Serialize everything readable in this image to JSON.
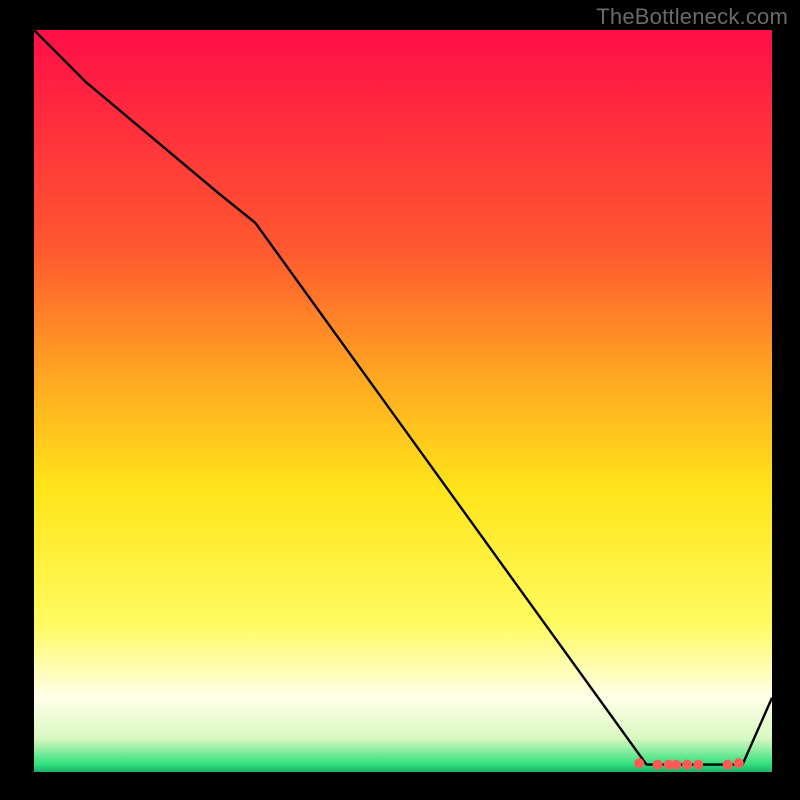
{
  "watermark": "TheBottleneck.com",
  "colors": {
    "background": "#000000",
    "watermark": "#6a6a6a",
    "line": "#000000",
    "marker": "#ff5a55",
    "gradient_top": "#ff0e47",
    "gradient_mid_upper": "#ff8a2b",
    "gradient_mid": "#ffd21a",
    "gradient_mid_lower": "#fff33a",
    "gradient_pale": "#ffffe0",
    "gradient_green": "#2fe07e"
  },
  "chart_data": {
    "type": "line",
    "title": "",
    "xlabel": "",
    "ylabel": "",
    "xlim": [
      0,
      100
    ],
    "ylim": [
      0,
      100
    ],
    "series": [
      {
        "name": "curve",
        "x": [
          0,
          7,
          25,
          30,
          83,
          96,
          100
        ],
        "values": [
          100,
          93,
          78,
          74,
          1,
          1,
          10
        ]
      }
    ],
    "markers": {
      "name": "highlight-points",
      "x": [
        82,
        84.5,
        86,
        87,
        88.5,
        90,
        94,
        95.5
      ],
      "values": [
        1.2,
        1.0,
        1.0,
        1.0,
        1.0,
        1.0,
        1.0,
        1.2
      ]
    },
    "background_gradient": {
      "direction": "vertical",
      "stops": [
        {
          "pos": 0.0,
          "color": "#ff0e47"
        },
        {
          "pos": 0.3,
          "color": "#ff5a2f"
        },
        {
          "pos": 0.48,
          "color": "#ffad20"
        },
        {
          "pos": 0.62,
          "color": "#ffe51a"
        },
        {
          "pos": 0.8,
          "color": "#fffb60"
        },
        {
          "pos": 0.9,
          "color": "#ffffe9"
        },
        {
          "pos": 0.955,
          "color": "#d9f8c0"
        },
        {
          "pos": 0.99,
          "color": "#2fe07e"
        },
        {
          "pos": 1.0,
          "color": "#1fae68"
        }
      ]
    }
  }
}
